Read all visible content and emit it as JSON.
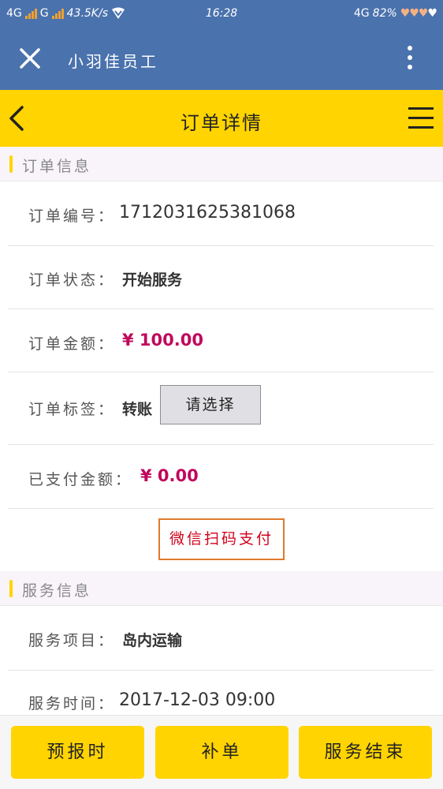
{
  "status_bar": {
    "network_left": "4G",
    "network_left2": "G",
    "speed": "43.5K/s",
    "time": "16:28",
    "network_right": "4G",
    "battery": "82%",
    "icons": [
      "signal-icon",
      "wifi-shield-icon",
      "heart-battery-icon"
    ]
  },
  "app_bar": {
    "title": "小羽佳员工"
  },
  "nav_bar": {
    "title": "订单详情"
  },
  "order_section": {
    "title": "订单信息",
    "order_no_label": "订单编号：",
    "order_no": "1712031625381068",
    "status_label": "订单状态：",
    "status": "开始服务",
    "amount_label": "订单金额：",
    "amount": "¥ 100.00",
    "tag_label": "订单标签：",
    "tag": "转账",
    "tag_select": "请选择",
    "paid_label": "已支付金额：",
    "paid": "¥ 0.00",
    "pay_button": "微信扫码支付"
  },
  "service_section": {
    "title": "服务信息",
    "item_label": "服务项目：",
    "item": "岛内运输",
    "time_label": "服务时间：",
    "time": "2017-12-03 09:00"
  },
  "bottom_bar": {
    "btn_report": "预报时",
    "btn_supplement": "补单",
    "btn_finish": "服务结束"
  },
  "colors": {
    "header_blue": "#4a72ad",
    "accent_yellow": "#ffd400",
    "money": "#c0085c",
    "pay_text": "#d0021b"
  }
}
